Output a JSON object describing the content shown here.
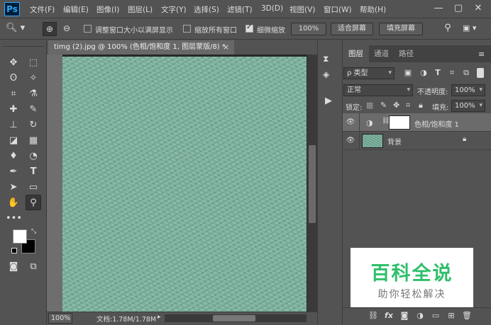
{
  "app": {
    "logo": "Ps"
  },
  "menu": [
    "文件(F)",
    "编辑(E)",
    "图像(I)",
    "图层(L)",
    "文字(Y)",
    "选择(S)",
    "滤镜(T)",
    "3D(D)",
    "视图(V)",
    "窗口(W)",
    "帮助(H)"
  ],
  "window_controls": {
    "minimize": "—",
    "restore": "▢",
    "close": "✕"
  },
  "options": {
    "resize_windows_label": "调整窗口大小以满屏显示",
    "zoom_all_windows_label": "缩放所有窗口",
    "scrubby_zoom_label": "细微缩放",
    "zoom_value": "100%",
    "fit_screen": "适合屏幕",
    "fill_screen": "填充屏幕",
    "resize_checked": false,
    "zoom_all_checked": false,
    "scrubby_checked": true
  },
  "document": {
    "tab_title": "timg (2).jpg @ 100% (色相/饱和度 1, 图层蒙版/8) *",
    "tab_close": "×",
    "zoom": "100%",
    "info": "文档:1.78M/1.78M",
    "texture_color": "#7fb4a0"
  },
  "panel": {
    "tabs": [
      "图层",
      "通道",
      "路径"
    ],
    "filter_kind": "ρ 类型",
    "blend_mode": "正常",
    "opacity_label": "不透明度:",
    "opacity_value": "100%",
    "lock_label": "锁定:",
    "fill_label": "填充:",
    "fill_value": "100%"
  },
  "layers": [
    {
      "name": "色相/饱和度 1",
      "visible": true,
      "selected": true
    },
    {
      "name": "背景",
      "visible": true,
      "selected": false
    }
  ],
  "watermark": {
    "title": "百科全说",
    "subtitle": "助你轻松解决"
  }
}
